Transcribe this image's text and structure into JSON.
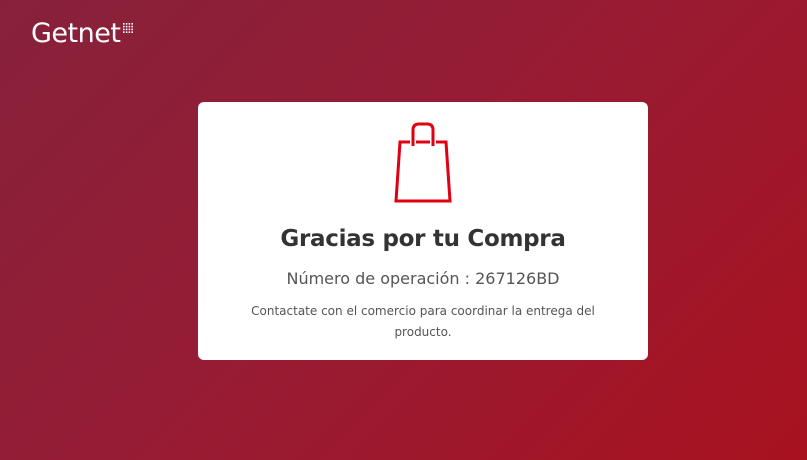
{
  "header": {
    "logo_text": "Getnet",
    "logo_dots_icon": "grid-dots-icon"
  },
  "card": {
    "icon": "shopping-bag-icon",
    "title": "Gracias por tu Compra",
    "operation_text": "Número de operación : 267126BD",
    "message": "Contactate con el comercio para coordinar la entrega del producto."
  },
  "colors": {
    "background_start": "#87213a",
    "background_end": "#a8121f",
    "card_background": "#ffffff",
    "icon_red": "#e00012",
    "title_text": "#333333",
    "body_text": "#555555"
  }
}
